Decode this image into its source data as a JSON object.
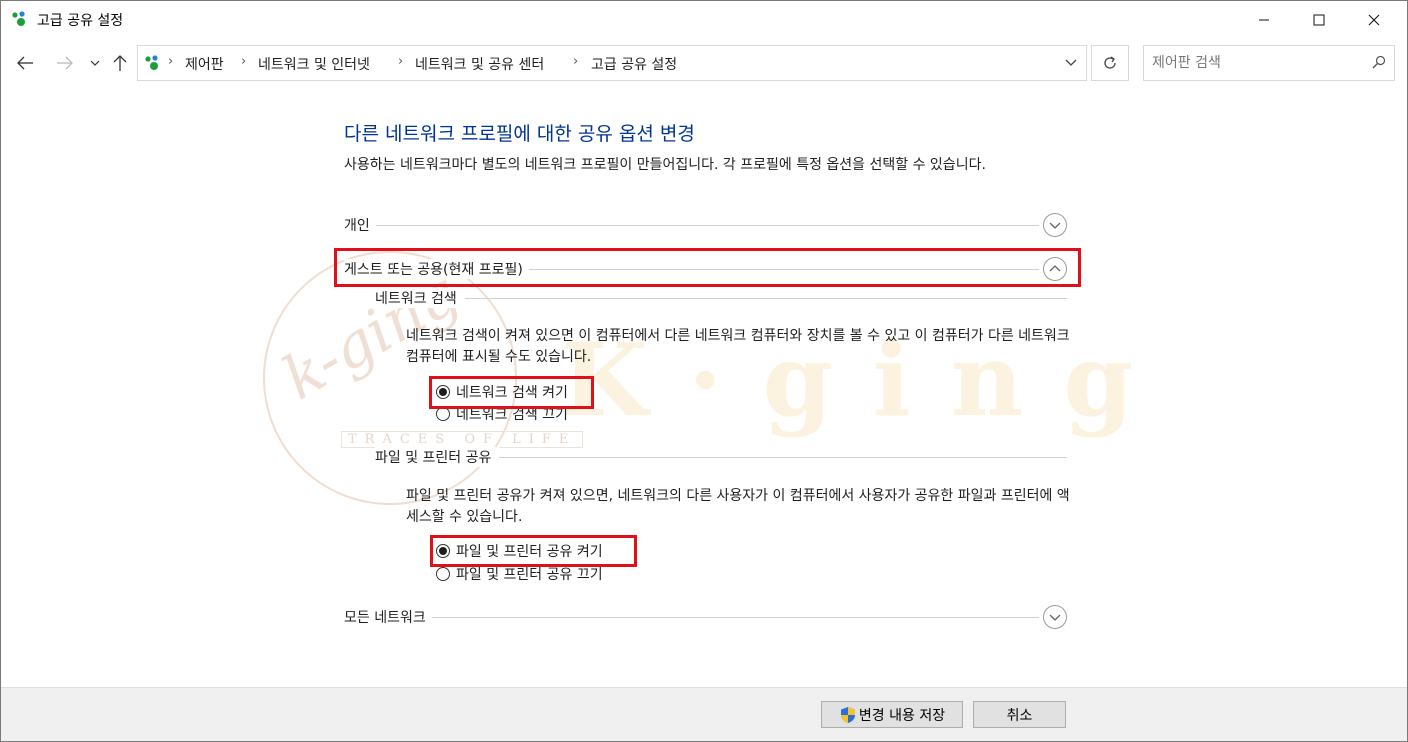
{
  "window": {
    "title": "고급 공유 설정"
  },
  "nav": {
    "breadcrumb": [
      "제어판",
      "네트워크 및 인터넷",
      "네트워크 및 공유 센터",
      "고급 공유 설정"
    ],
    "search_placeholder": "제어판 검색"
  },
  "main": {
    "heading": "다른 네트워크 프로필에 대한 공유 옵션 변경",
    "description": "사용하는 네트워크마다 별도의 네트워크 프로필이 만들어집니다. 각 프로필에 특정 옵션을 선택할 수 있습니다.",
    "profiles": {
      "private": {
        "label": "개인",
        "expanded": false
      },
      "guest": {
        "label": "게스트 또는 공용(현재 프로필)",
        "expanded": true
      },
      "all": {
        "label": "모든 네트워크",
        "expanded": false
      }
    },
    "network_discovery": {
      "title": "네트워크 검색",
      "text": "네트워크 검색이 켜져 있으면 이 컴퓨터에서 다른 네트워크 컴퓨터와 장치를 볼 수 있고 이 컴퓨터가 다른 네트워크 컴퓨터에 표시될 수도 있습니다.",
      "on_label": "네트워크 검색 켜기",
      "off_label": "네트워크 검색 끄기",
      "selected": "on"
    },
    "file_sharing": {
      "title": "파일 및 프린터 공유",
      "text": "파일 및 프린터 공유가 켜져 있으면, 네트워크의 다른 사용자가 이 컴퓨터에서 사용자가 공유한 파일과 프린터에 액세스할 수 있습니다.",
      "on_label": "파일 및 프린터 공유 켜기",
      "off_label": "파일 및 프린터 공유 끄기",
      "selected": "on"
    }
  },
  "watermark": {
    "text": "K-ging",
    "sub": "TRACES OF LIFE"
  },
  "footer": {
    "save_label": "변경 내용 저장",
    "cancel_label": "취소"
  },
  "colors": {
    "heading": "#003399",
    "highlight": "#e0101a",
    "footer_bg": "#f0f0f0"
  }
}
